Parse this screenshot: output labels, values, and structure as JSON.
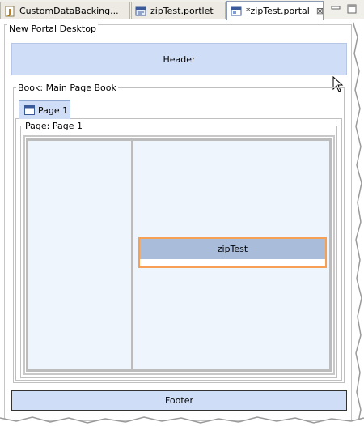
{
  "tabs": [
    {
      "label": "CustomDataBacking...",
      "icon": "java-class-icon"
    },
    {
      "label": "zipTest.portlet",
      "icon": "portlet-file-icon"
    },
    {
      "label": "*zipTest.portal",
      "icon": "portal-file-icon",
      "close": "⊠"
    }
  ],
  "desktop": {
    "legend": "New Portal Desktop"
  },
  "header": {
    "label": "Header"
  },
  "book": {
    "legend": "Book: Main Page Book",
    "tab_label": "Page 1"
  },
  "page": {
    "legend": "Page: Page 1"
  },
  "portlet": {
    "title": "zipTest"
  },
  "footer": {
    "label": "Footer"
  },
  "colors": {
    "accent_blue": "#cfddf7",
    "column_bg": "#eef5fd",
    "portlet_border": "#f6a055",
    "portlet_title_bg": "#a9bdda"
  }
}
